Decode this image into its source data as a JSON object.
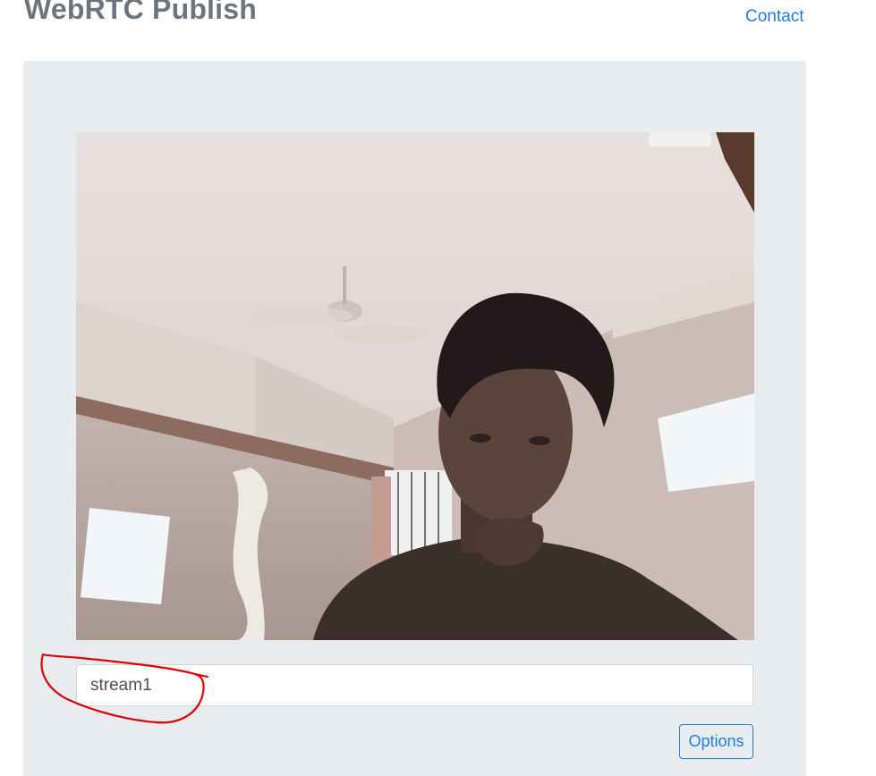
{
  "header": {
    "brand": "WebRTC Publish",
    "nav_contact": "Contact"
  },
  "publish": {
    "stream_name_value": "stream1",
    "options_label": "Options"
  },
  "colors": {
    "link": "#1f7bdf",
    "panel_bg": "#e9ecef",
    "brand_text": "#6c757d",
    "annotation": "#e00000"
  }
}
